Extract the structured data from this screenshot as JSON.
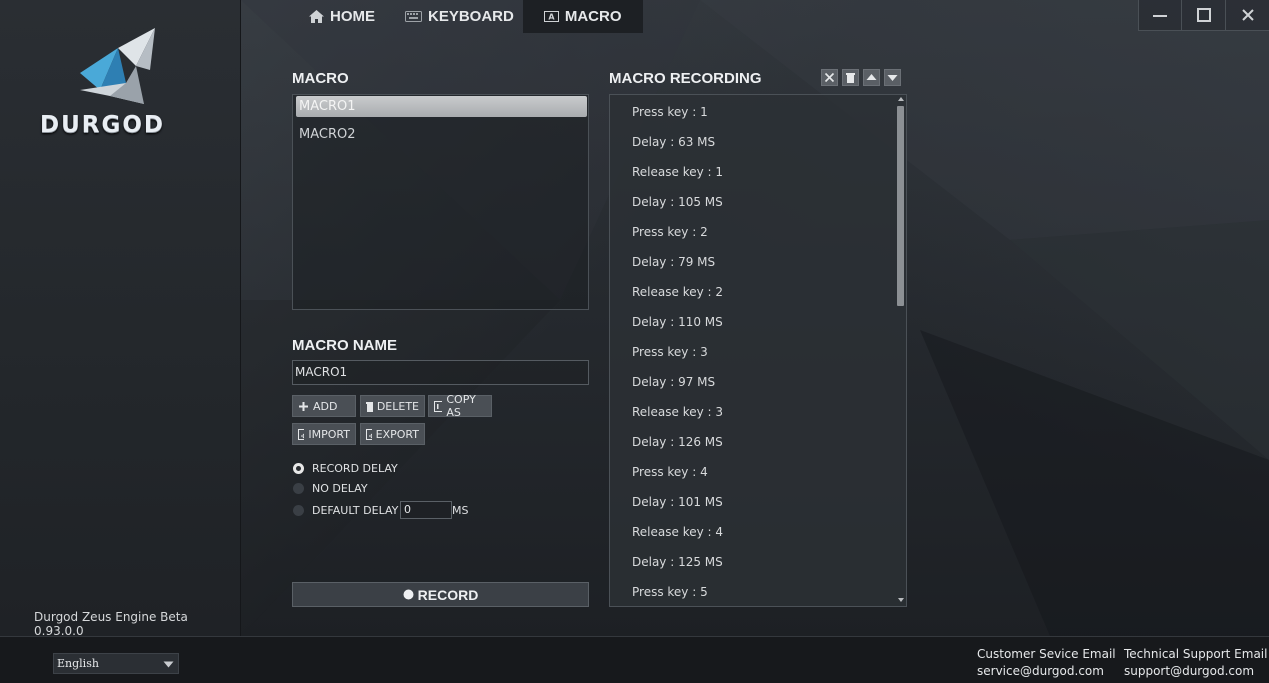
{
  "brand": {
    "logo_text": "DURGOD",
    "version": "Durgod Zeus Engine Beta 0.93.0.0"
  },
  "nav": {
    "tabs": [
      {
        "label": "HOME",
        "icon": "home-icon"
      },
      {
        "label": "KEYBOARD",
        "icon": "keyboard-icon"
      },
      {
        "label": "MACRO",
        "icon": "macro-icon",
        "active": true
      }
    ]
  },
  "macro": {
    "title": "MACRO",
    "items": [
      "MACRO1",
      "MACRO2"
    ],
    "selected": "MACRO1",
    "name_title": "MACRO NAME",
    "name_value": "MACRO1",
    "buttons": {
      "add": "ADD",
      "delete": "DELETE",
      "copy_as": "COPY AS",
      "import": "IMPORT",
      "export": "EXPORT"
    },
    "delay_options": {
      "record_delay": "RECORD DELAY",
      "no_delay": "NO DELAY",
      "default_delay": "DEFAULT DELAY",
      "default_delay_value": "0",
      "unit": "MS",
      "selected": "record_delay"
    },
    "record_label": "RECORD"
  },
  "recording": {
    "title": "MACRO RECORDING",
    "events": [
      "Press key : 1",
      "Delay : 63 MS",
      "Release key : 1",
      "Delay : 105 MS",
      "Press key : 2",
      "Delay : 79 MS",
      "Release key : 2",
      "Delay : 110 MS",
      "Press key : 3",
      "Delay : 97 MS",
      "Release key : 3",
      "Delay : 126 MS",
      "Press key : 4",
      "Delay : 101 MS",
      "Release key : 4",
      "Delay : 125 MS",
      "Press key : 5"
    ]
  },
  "footer": {
    "language": "English",
    "customer_label": "Customer Sevice Email",
    "customer_email": "service@durgod.com",
    "support_label": "Technical Support Email",
    "support_email": "support@durgod.com"
  },
  "colors": {
    "background": "#25292e",
    "accent_blue": "#59b7e6",
    "selected_item": "#b9bbbe"
  }
}
